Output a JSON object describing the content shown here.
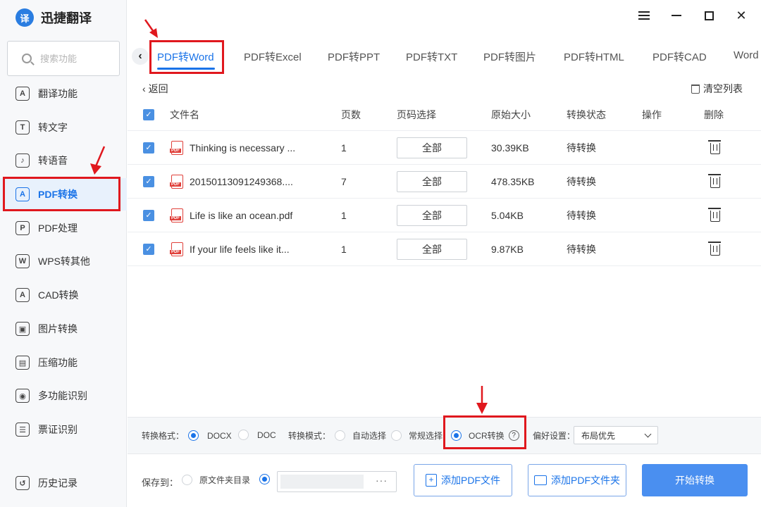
{
  "app": {
    "logo_char": "译",
    "name": "迅捷翻译"
  },
  "search": {
    "placeholder": "搜索功能"
  },
  "sidebar": {
    "items": [
      {
        "label": "翻译功能",
        "icon": "A"
      },
      {
        "label": "转文字",
        "icon": "T"
      },
      {
        "label": "转语音",
        "icon": "♪"
      },
      {
        "label": "PDF转换",
        "icon": "A",
        "active": true
      },
      {
        "label": "PDF处理",
        "icon": "P"
      },
      {
        "label": "WPS转其他",
        "icon": "W"
      },
      {
        "label": "CAD转换",
        "icon": "A"
      },
      {
        "label": "图片转换",
        "icon": "▣"
      },
      {
        "label": "压缩功能",
        "icon": "▤"
      },
      {
        "label": "多功能识别",
        "icon": "◉"
      },
      {
        "label": "票证识别",
        "icon": "☰"
      },
      {
        "label": "历史记录",
        "icon": "↺"
      }
    ]
  },
  "tabs": [
    "PDF转Word",
    "PDF转Excel",
    "PDF转PPT",
    "PDF转TXT",
    "PDF转图片",
    "PDF转HTML",
    "PDF转CAD",
    "Word"
  ],
  "toolbar": {
    "back": "返回",
    "clear": "清空列表"
  },
  "table": {
    "headers": {
      "name": "文件名",
      "pages": "页数",
      "page_select": "页码选择",
      "size": "原始大小",
      "status": "转换状态",
      "action": "操作",
      "delete": "删除"
    },
    "rows": [
      {
        "name": "Thinking is necessary ...",
        "pages": "1",
        "page_select": "全部",
        "size": "30.39KB",
        "status": "待转换"
      },
      {
        "name": "20150113091249368....",
        "pages": "7",
        "page_select": "全部",
        "size": "478.35KB",
        "status": "待转换"
      },
      {
        "name": "Life is like an ocean.pdf",
        "pages": "1",
        "page_select": "全部",
        "size": "5.04KB",
        "status": "待转换"
      },
      {
        "name": "If your life feels like it...",
        "pages": "1",
        "page_select": "全部",
        "size": "9.87KB",
        "status": "待转换"
      }
    ]
  },
  "options": {
    "format_label": "转换格式：",
    "format_docx": "DOCX",
    "format_doc": "DOC",
    "mode_label": "转换模式：",
    "mode_auto": "自动选择",
    "mode_normal": "常规选择",
    "mode_ocr": "OCR转换",
    "help": "?",
    "pref_label": "偏好设置：",
    "pref_value": "布局优先"
  },
  "bottom": {
    "save_label": "保存到：",
    "source_dir": "原文件夹目录",
    "browse": "···",
    "add_file": "添加PDF文件",
    "add_folder": "添加PDF文件夹",
    "start": "开始转换"
  },
  "colors": {
    "accent": "#1a73e8",
    "highlight_red": "#e0181e",
    "primary_button": "#4a8ff0"
  }
}
